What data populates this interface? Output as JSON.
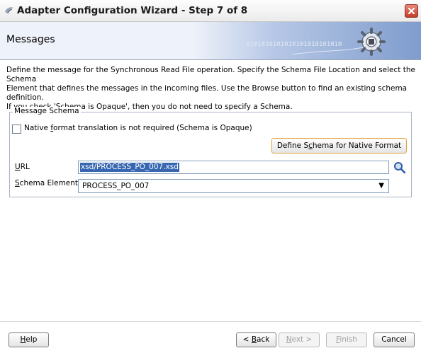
{
  "window": {
    "title": "Adapter Configuration Wizard - Step 7 of 8"
  },
  "header": {
    "title": "Messages",
    "binary_text": "0101010101010101010101010",
    "icon": "gear-plug-icon"
  },
  "description": {
    "line1": "Define the message for the Synchronous Read File operation.  Specify the Schema File Location and select the Schema",
    "line2": "Element that defines the messages in the incoming files. Use the Browse button to find an existing schema definition.",
    "line3": "If you check 'Schema is Opaque', then you do not need to specify a Schema."
  },
  "schema_group": {
    "legend": "Message Schema",
    "opaque_checkbox": {
      "label_before": "Native ",
      "label_mnemonic": "f",
      "label_after": "ormat translation is not required (Schema is Opaque)",
      "checked": false
    },
    "define_button": {
      "label_before": "Define S",
      "label_mnemonic": "c",
      "label_after": "hema for Native Format"
    },
    "url": {
      "label_mnemonic": "U",
      "label_after": "RL",
      "value": "xsd/PROCESS_PO_007.xsd"
    },
    "schema_element": {
      "label_mnemonic": "S",
      "label_after": "chema Element",
      "value": "PROCESS_PO_007"
    }
  },
  "buttons": {
    "help": {
      "mnemonic": "H",
      "rest": "elp"
    },
    "back": {
      "before": "< ",
      "mnemonic": "B",
      "rest": "ack"
    },
    "next": {
      "mnemonic": "N",
      "rest": "ext >"
    },
    "finish": {
      "mnemonic": "F",
      "rest": "inish"
    },
    "cancel": {
      "label": "Cancel"
    }
  },
  "colors": {
    "accent": "#3667b0",
    "close": "#c53d2a",
    "define_border": "#e0a33a"
  }
}
